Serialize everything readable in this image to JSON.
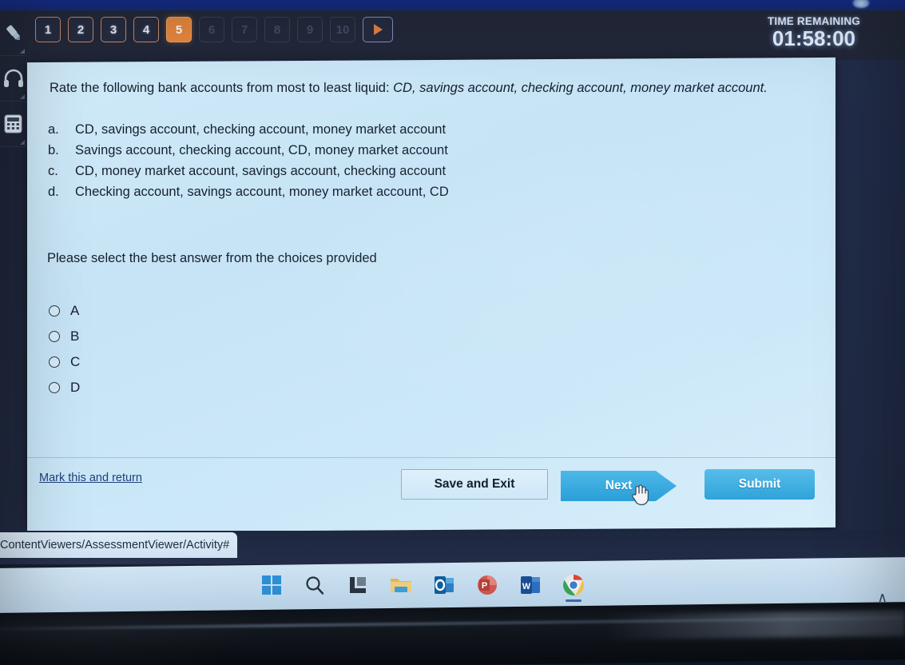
{
  "os": {
    "top_strip": "",
    "taskbar": {
      "icons": [
        {
          "name": "windows-start-icon",
          "label": "Start"
        },
        {
          "name": "search-icon",
          "label": "Search"
        },
        {
          "name": "task-view-icon",
          "label": "Task View"
        },
        {
          "name": "file-explorer-icon",
          "label": "File Explorer"
        },
        {
          "name": "outlook-icon",
          "label": "Outlook"
        },
        {
          "name": "powerpoint-icon",
          "label": "PowerPoint"
        },
        {
          "name": "word-icon",
          "label": "Word"
        },
        {
          "name": "chrome-icon",
          "label": "Google Chrome"
        }
      ],
      "show_hidden_icons": "∧"
    }
  },
  "browser": {
    "url_text": "ContentViewers/AssessmentViewer/Activity#"
  },
  "tool_rail": {
    "items": [
      {
        "name": "highlighter-icon",
        "label": "Highlighter"
      },
      {
        "name": "headphones-icon",
        "label": "Audio"
      },
      {
        "name": "calculator-icon",
        "label": "Calculator"
      }
    ]
  },
  "nav": {
    "questions": [
      {
        "label": "1",
        "state": "answered"
      },
      {
        "label": "2",
        "state": "answered"
      },
      {
        "label": "3",
        "state": "answered"
      },
      {
        "label": "4",
        "state": "answered"
      },
      {
        "label": "5",
        "state": "current"
      },
      {
        "label": "6",
        "state": "disabled"
      },
      {
        "label": "7",
        "state": "disabled"
      },
      {
        "label": "8",
        "state": "disabled"
      },
      {
        "label": "9",
        "state": "disabled"
      },
      {
        "label": "10",
        "state": "disabled"
      }
    ],
    "next_arrow_label": "▶",
    "timer": {
      "label": "TIME REMAINING",
      "value": "01:58:00"
    }
  },
  "question": {
    "stem_plain": "Rate the following bank accounts from most to least liquid: ",
    "stem_italic": "CD, savings account, checking account, money market account.",
    "choices": [
      {
        "letter": "a.",
        "text": "CD, savings account, checking account, money market account"
      },
      {
        "letter": "b.",
        "text": "Savings account, checking account, CD, money market account"
      },
      {
        "letter": "c.",
        "text": "CD, money market account, savings account, checking account"
      },
      {
        "letter": "d.",
        "text": "Checking account, savings account, money market account, CD"
      }
    ],
    "prompt": "Please select the best answer from the choices provided",
    "options": [
      {
        "value": "A",
        "selected": false
      },
      {
        "value": "B",
        "selected": false
      },
      {
        "value": "C",
        "selected": false
      },
      {
        "value": "D",
        "selected": false
      }
    ]
  },
  "footer": {
    "mark_link": "Mark this and return",
    "save_and_exit": "Save and Exit",
    "next": "Next",
    "submit": "Submit"
  },
  "colors": {
    "accent_orange": "#e8893f",
    "button_blue": "#2fa3d9",
    "card_bg": "#cbe6f7",
    "desktop_navy": "#243050",
    "link_blue": "#1d3f7a"
  }
}
